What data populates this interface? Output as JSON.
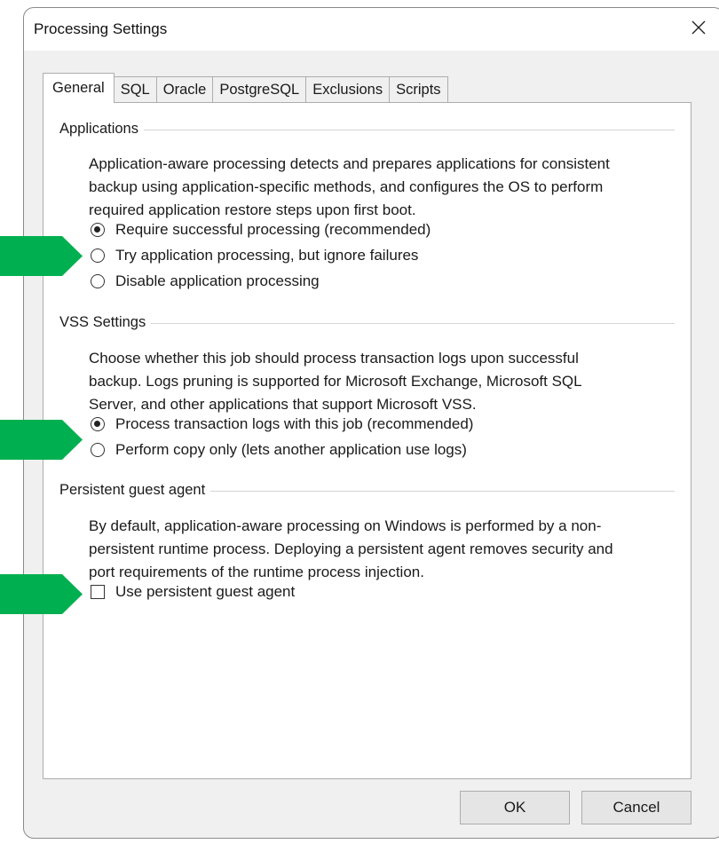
{
  "window": {
    "title": "Processing Settings",
    "close_icon": "close-icon"
  },
  "tabs": [
    {
      "label": "General",
      "active": true
    },
    {
      "label": "SQL",
      "active": false
    },
    {
      "label": "Oracle",
      "active": false
    },
    {
      "label": "PostgreSQL",
      "active": false
    },
    {
      "label": "Exclusions",
      "active": false
    },
    {
      "label": "Scripts",
      "active": false
    }
  ],
  "applications": {
    "title": "Applications",
    "description_lines": [
      "Application-aware processing detects and prepares applications for consistent",
      "backup using application-specific methods, and configures the OS to perform",
      "required application restore steps upon first boot."
    ],
    "options": [
      {
        "label": "Require successful processing (recommended)",
        "selected": true
      },
      {
        "label": "Try application processing, but ignore failures",
        "selected": false
      },
      {
        "label": "Disable application processing",
        "selected": false
      }
    ]
  },
  "vss": {
    "title": "VSS Settings",
    "description_lines": [
      "Choose whether this job should process transaction logs upon successful",
      "backup. Logs pruning is supported for Microsoft Exchange, Microsoft SQL",
      "Server, and other applications that support Microsoft VSS."
    ],
    "options": [
      {
        "label": "Process transaction logs with this job (recommended)",
        "selected": true
      },
      {
        "label": "Perform copy only (lets another application use logs)",
        "selected": false
      }
    ]
  },
  "guest_agent": {
    "title": "Persistent guest agent",
    "description_lines": [
      "By default, application-aware processing on Windows is performed by a non-",
      "persistent runtime process. Deploying a persistent agent removes security and",
      "port requirements of the runtime process injection."
    ],
    "checkbox": {
      "label": "Use persistent guest agent",
      "checked": false
    }
  },
  "buttons": {
    "ok": "OK",
    "cancel": "Cancel"
  },
  "colors": {
    "arrow": "#00b050",
    "dialog_bg": "#f0f0f0",
    "panel_bg": "#ffffff"
  }
}
